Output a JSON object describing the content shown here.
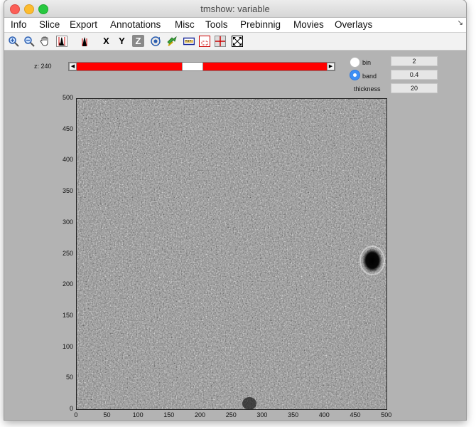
{
  "window": {
    "title": "tmshow: variable"
  },
  "menu": {
    "items": [
      "Info",
      "Slice",
      "Export",
      "Annotations",
      "Misc",
      "Tools",
      "Prebinnig",
      "Movies",
      "Overlays"
    ]
  },
  "toolbar": {
    "tools": [
      "zoom-in-icon",
      "zoom-out-icon",
      "pan-hand-icon",
      "histogram-icon",
      "histogram-small-icon",
      "x-axis-icon",
      "y-axis-icon",
      "z-axis-icon",
      "rotate-icon",
      "sync-icon",
      "ruler-icon",
      "dotted-box-icon",
      "crosshair-icon",
      "fit-window-icon"
    ],
    "x_label": "X",
    "y_label": "Y",
    "z_label": "Z"
  },
  "slice": {
    "label": "z: 240",
    "fraction": 0.46
  },
  "options": {
    "bin_label": "bin",
    "bin_value": "2",
    "band_label": "band",
    "band_value": "0.4",
    "thickness_label": "thickness",
    "thickness_value": "20",
    "selected": "band"
  },
  "plot": {
    "x_ticks": [
      "0",
      "50",
      "100",
      "150",
      "200",
      "250",
      "300",
      "350",
      "400",
      "450",
      "500"
    ],
    "y_ticks": [
      "500",
      "450",
      "400",
      "350",
      "300",
      "250",
      "200",
      "150",
      "100",
      "50",
      "0"
    ],
    "xlim": [
      0,
      500
    ],
    "ylim": [
      0,
      500
    ]
  },
  "colors": {
    "slider_track": "#ff0000",
    "selected_radio": "#3d8ff5"
  }
}
